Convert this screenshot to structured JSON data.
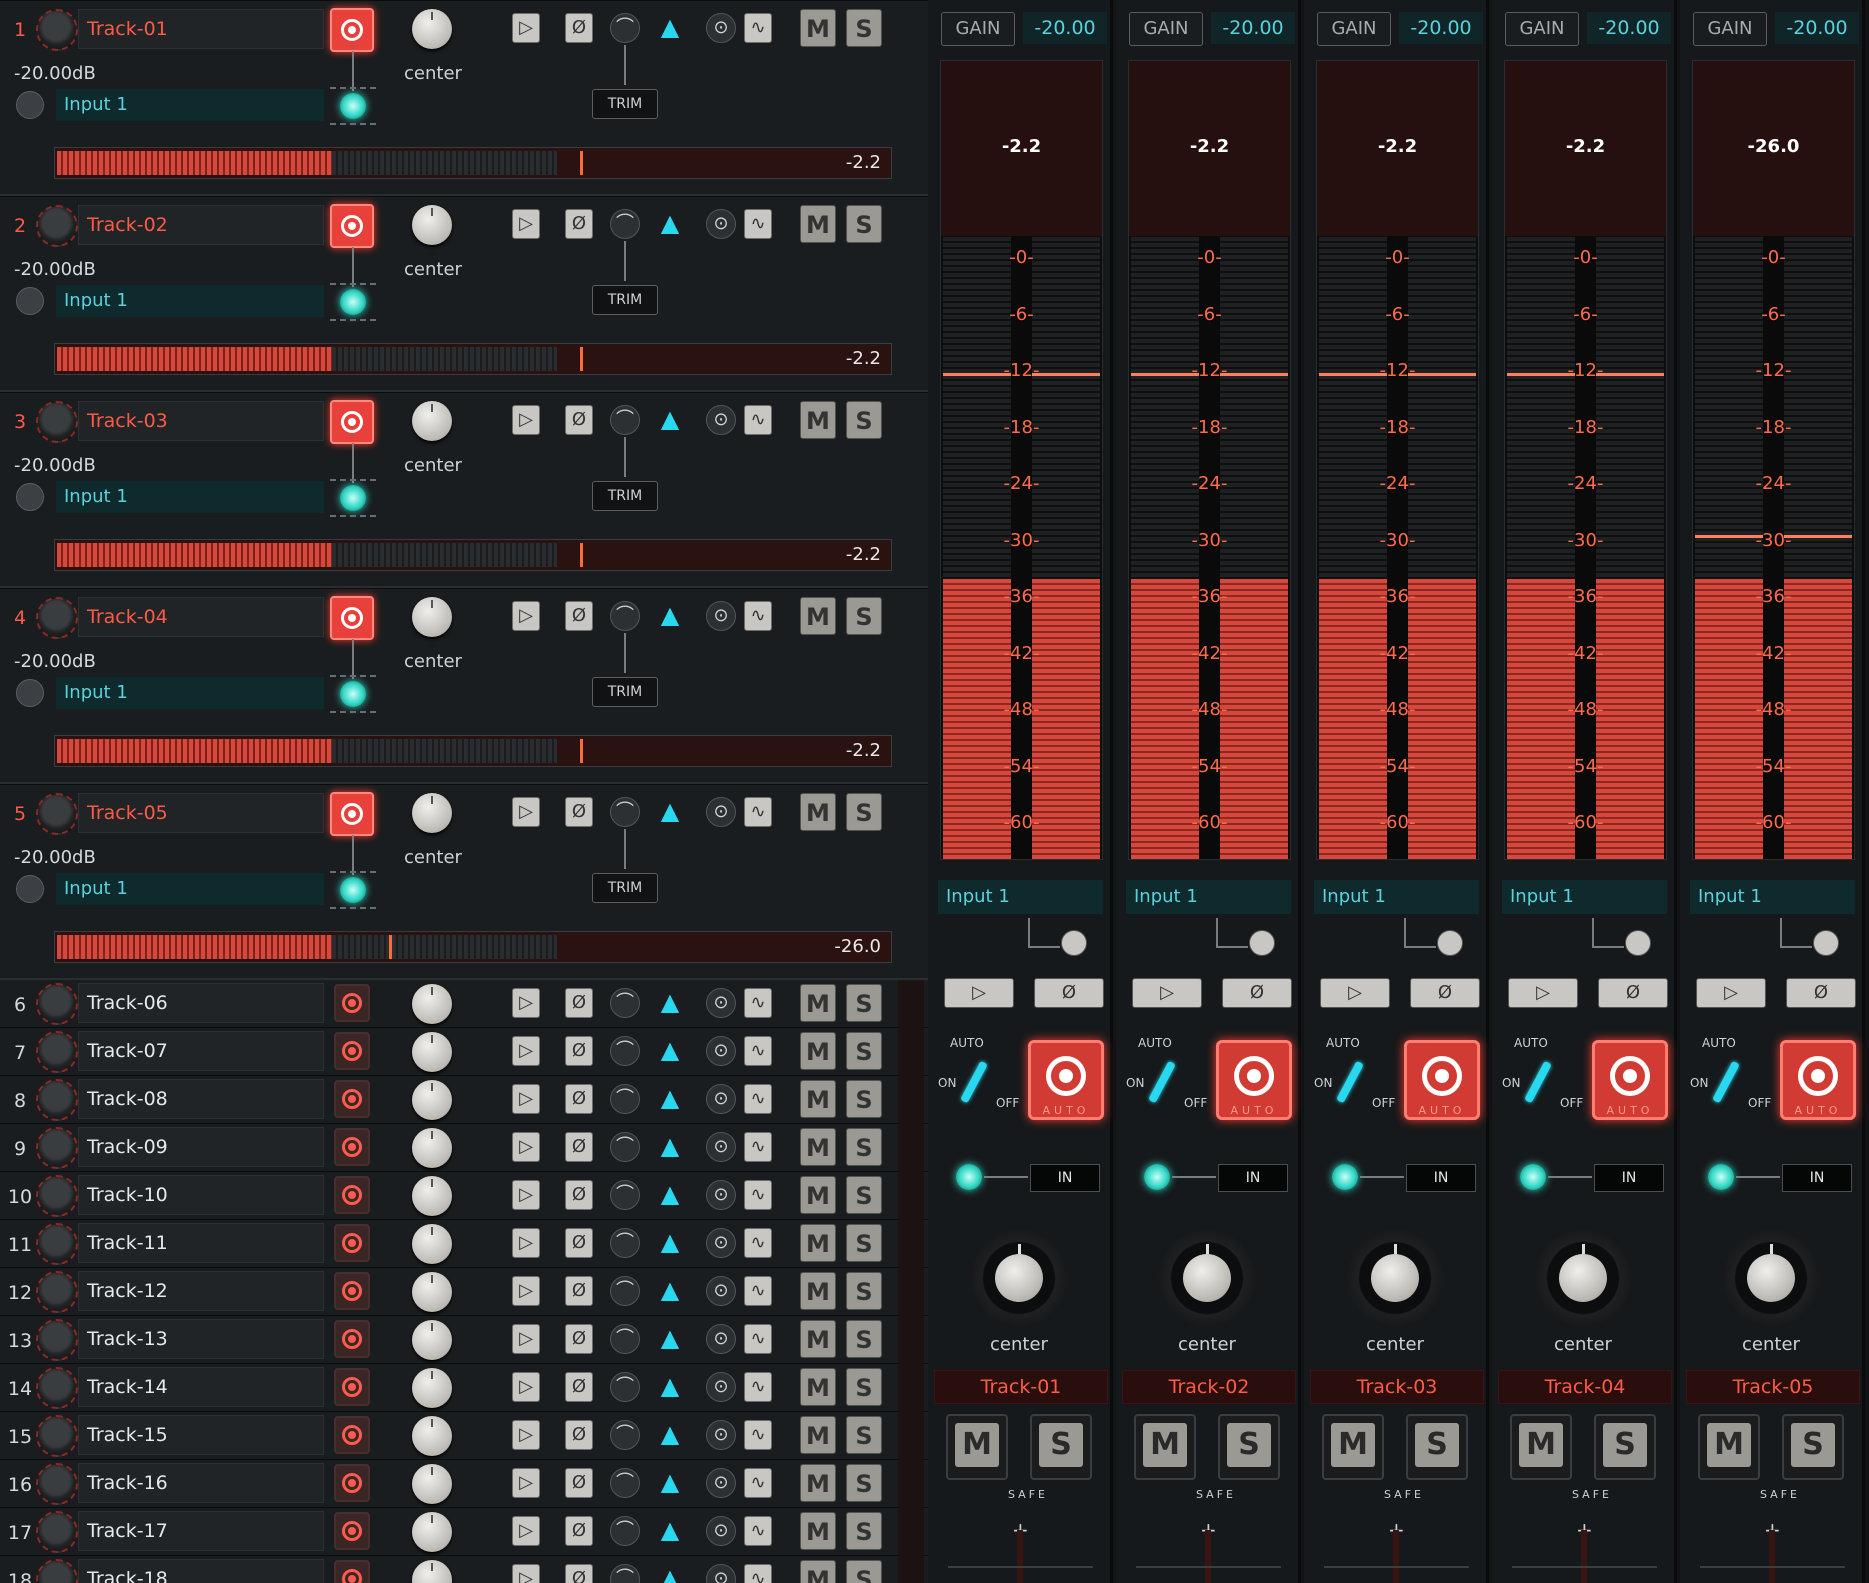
{
  "expanded_tracks": [
    {
      "number": "1",
      "name": "Track-01",
      "db": "-20.00dB",
      "pan": "center",
      "input": "Input 1",
      "trim": "TRIM",
      "meter_value": "-2.2",
      "meter_fill_fraction": 0.33,
      "peak_fraction": 0.63
    },
    {
      "number": "2",
      "name": "Track-02",
      "db": "-20.00dB",
      "pan": "center",
      "input": "Input 1",
      "trim": "TRIM",
      "meter_value": "-2.2",
      "meter_fill_fraction": 0.33,
      "peak_fraction": 0.63
    },
    {
      "number": "3",
      "name": "Track-03",
      "db": "-20.00dB",
      "pan": "center",
      "input": "Input 1",
      "trim": "TRIM",
      "meter_value": "-2.2",
      "meter_fill_fraction": 0.33,
      "peak_fraction": 0.63
    },
    {
      "number": "4",
      "name": "Track-04",
      "db": "-20.00dB",
      "pan": "center",
      "input": "Input 1",
      "trim": "TRIM",
      "meter_value": "-2.2",
      "meter_fill_fraction": 0.33,
      "peak_fraction": 0.63
    },
    {
      "number": "5",
      "name": "Track-05",
      "db": "-20.00dB",
      "pan": "center",
      "input": "Input 1",
      "trim": "TRIM",
      "meter_value": "-26.0",
      "meter_fill_fraction": 0.33,
      "peak_fraction": 0.4
    }
  ],
  "collapsed_tracks": [
    {
      "number": "6",
      "name": "Track-06"
    },
    {
      "number": "7",
      "name": "Track-07"
    },
    {
      "number": "8",
      "name": "Track-08"
    },
    {
      "number": "9",
      "name": "Track-09"
    },
    {
      "number": "10",
      "name": "Track-10"
    },
    {
      "number": "11",
      "name": "Track-11"
    },
    {
      "number": "12",
      "name": "Track-12"
    },
    {
      "number": "13",
      "name": "Track-13"
    },
    {
      "number": "14",
      "name": "Track-14"
    },
    {
      "number": "15",
      "name": "Track-15"
    },
    {
      "number": "16",
      "name": "Track-16"
    },
    {
      "number": "17",
      "name": "Track-17"
    },
    {
      "number": "18",
      "name": "Track-18"
    }
  ],
  "track_buttons": {
    "mute": "M",
    "solo": "S",
    "phase": "Ø"
  },
  "strips": [
    {
      "gain_label": "GAIN",
      "gain_value": "-20.00",
      "peak": "-2.2",
      "meter_fill_fraction": 0.45,
      "hold_fraction": 0.78,
      "input": "Input 1",
      "auto": "AUTO",
      "on": "ON",
      "off": "OFF",
      "auto_rec": "AUTO",
      "in_button": "IN",
      "pan": "center",
      "name": "Track-01",
      "mute": "M",
      "solo": "S",
      "safe": "SAFE"
    },
    {
      "gain_label": "GAIN",
      "gain_value": "-20.00",
      "peak": "-2.2",
      "meter_fill_fraction": 0.45,
      "hold_fraction": 0.78,
      "input": "Input 1",
      "auto": "AUTO",
      "on": "ON",
      "off": "OFF",
      "auto_rec": "AUTO",
      "in_button": "IN",
      "pan": "center",
      "name": "Track-02",
      "mute": "M",
      "solo": "S",
      "safe": "SAFE"
    },
    {
      "gain_label": "GAIN",
      "gain_value": "-20.00",
      "peak": "-2.2",
      "meter_fill_fraction": 0.45,
      "hold_fraction": 0.78,
      "input": "Input 1",
      "auto": "AUTO",
      "on": "ON",
      "off": "OFF",
      "auto_rec": "AUTO",
      "in_button": "IN",
      "pan": "center",
      "name": "Track-03",
      "mute": "M",
      "solo": "S",
      "safe": "SAFE"
    },
    {
      "gain_label": "GAIN",
      "gain_value": "-20.00",
      "peak": "-2.2",
      "meter_fill_fraction": 0.45,
      "hold_fraction": 0.78,
      "input": "Input 1",
      "auto": "AUTO",
      "on": "ON",
      "off": "OFF",
      "auto_rec": "AUTO",
      "in_button": "IN",
      "pan": "center",
      "name": "Track-04",
      "mute": "M",
      "solo": "S",
      "safe": "SAFE"
    },
    {
      "gain_label": "GAIN",
      "gain_value": "-20.00",
      "peak": "-26.0",
      "meter_fill_fraction": 0.45,
      "hold_fraction": 0.52,
      "input": "Input 1",
      "auto": "AUTO",
      "on": "ON",
      "off": "OFF",
      "auto_rec": "AUTO",
      "in_button": "IN",
      "pan": "center",
      "name": "Track-05",
      "mute": "M",
      "solo": "S",
      "safe": "SAFE"
    }
  ],
  "meter_scale": [
    "-0-",
    "-6-",
    "-12-",
    "-18-",
    "-24-",
    "-30-",
    "-36-",
    "-42-",
    "-48-",
    "-54-",
    "-60-"
  ],
  "colors": {
    "accent_red": "#ff5a46",
    "cyan": "#2fd6c4",
    "meter_red": "#d8473c",
    "input_text": "#5ad2de"
  }
}
